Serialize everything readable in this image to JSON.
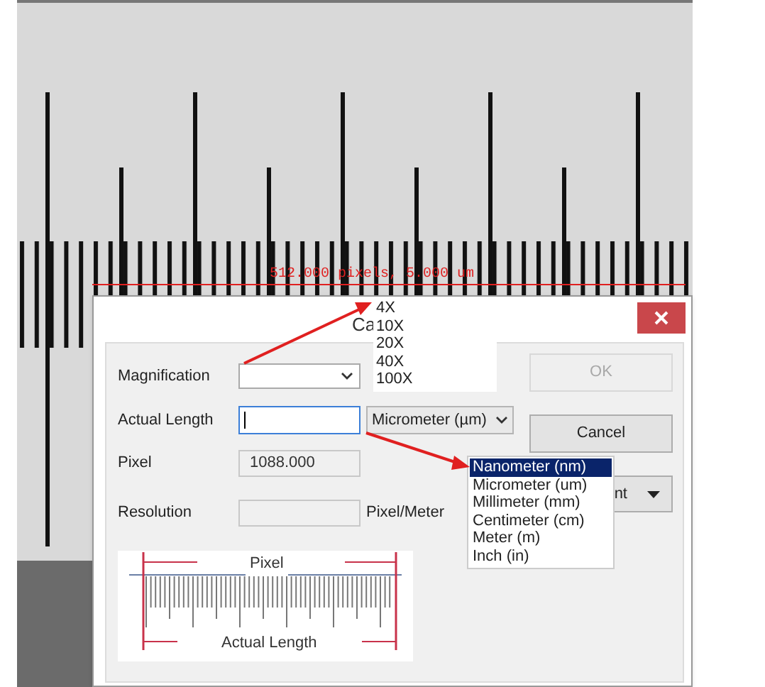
{
  "measurement": {
    "label": "512.000 pixels, 5.000 um"
  },
  "dialog": {
    "title": "Ca",
    "rows": [
      {
        "kind": "select",
        "label": "Magnification"
      },
      {
        "kind": "input",
        "label": "Actual Length",
        "focused": true,
        "unit_select": "Micrometer (µm)"
      },
      {
        "kind": "readonly",
        "label": "Pixel",
        "value": "1088.000"
      },
      {
        "kind": "readonly",
        "label": "Resolution",
        "unit": "Pixel/Meter"
      }
    ],
    "buttons": [
      {
        "label": "OK",
        "disabled": true
      },
      {
        "label": "Cancel",
        "disabled": false
      }
    ],
    "partial_dropdown": {
      "value": "nt"
    },
    "diagram": {
      "top_label": "Pixel",
      "bottom_label": "Actual Length"
    }
  },
  "magnification_list": [
    {
      "label": "4X",
      "selected": false
    },
    {
      "label": "10X",
      "selected": false
    },
    {
      "label": "20X",
      "selected": false
    },
    {
      "label": "40X",
      "selected": false
    },
    {
      "label": "100X",
      "selected": false
    }
  ],
  "unit_list": [
    {
      "label": "Nanometer (nm)",
      "selected": true
    },
    {
      "label": "Micrometer (um)",
      "selected": false
    },
    {
      "label": "Millimeter (mm)",
      "selected": false
    },
    {
      "label": "Centimeter (cm)",
      "selected": false
    },
    {
      "label": "Meter (m)",
      "selected": false
    },
    {
      "label": "Inch (in)",
      "selected": false
    }
  ]
}
